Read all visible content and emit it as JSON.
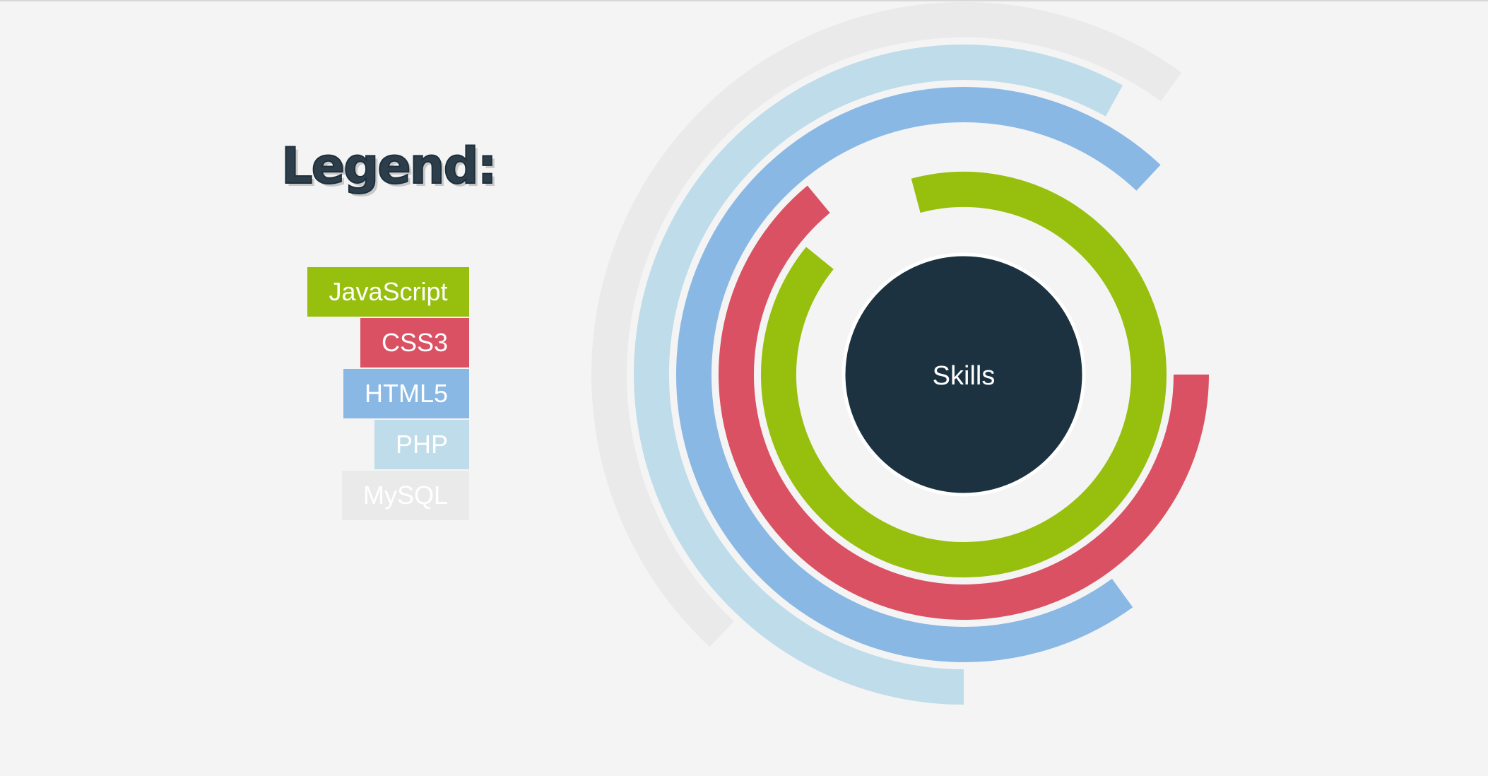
{
  "legend": {
    "title": "Legend:"
  },
  "chart_data": {
    "type": "radial-bar",
    "center_label": "Skills",
    "series": [
      {
        "name": "JavaScript",
        "color": "#97bf0d",
        "percent": 90
      },
      {
        "name": "CSS3",
        "color": "#d95163",
        "percent": 64
      },
      {
        "name": "HTML5",
        "color": "#89b8e5",
        "percent": 72
      },
      {
        "name": "PHP",
        "color": "#bedcea",
        "percent": 58
      },
      {
        "name": "MySQL",
        "color": "#ebeaeb",
        "percent": 48
      }
    ]
  },
  "colors": {
    "background": "#f4f4f4",
    "center": "#1c3240",
    "center_text": "#ffffff"
  }
}
